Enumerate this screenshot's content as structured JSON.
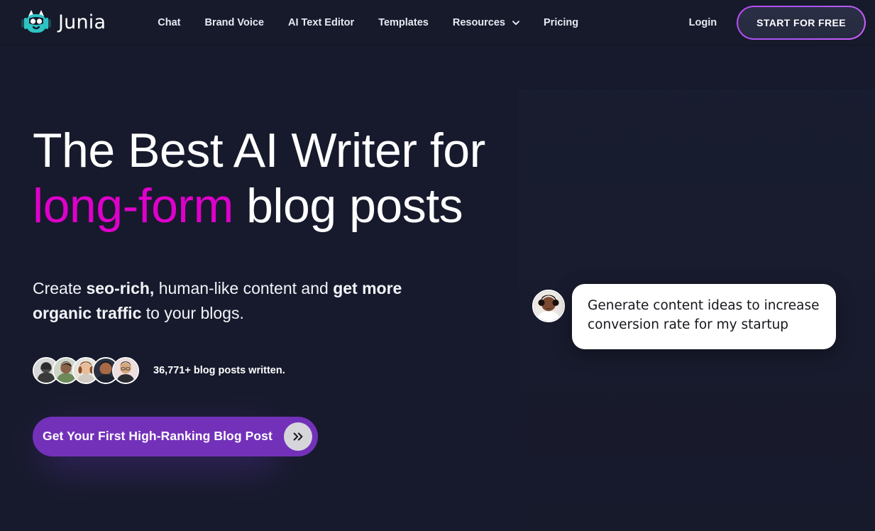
{
  "brand": {
    "name": "Junia",
    "logo_icon": "junia-robot-logo"
  },
  "nav": {
    "items": [
      {
        "label": "Chat",
        "has_dropdown": false
      },
      {
        "label": "Brand Voice",
        "has_dropdown": false
      },
      {
        "label": "AI Text Editor",
        "has_dropdown": false
      },
      {
        "label": "Templates",
        "has_dropdown": false
      },
      {
        "label": "Resources",
        "has_dropdown": true,
        "icon": "chevron-down-icon"
      },
      {
        "label": "Pricing",
        "has_dropdown": false
      }
    ],
    "login_label": "Login",
    "cta_label": "START FOR FREE"
  },
  "hero": {
    "headline_line1": "The Best AI Writer for",
    "headline_accent": "long-form",
    "headline_line2_rest": " blog posts",
    "sub_part1": "Create ",
    "sub_bold1": "seo-rich,",
    "sub_part2": " human-like content and ",
    "sub_bold2": "get more organic traffic",
    "sub_part3": " to your blogs.",
    "social_proof": "36,771+ blog posts written.",
    "cta_label": "Get Your First High-Ranking Blog Post",
    "cta_icon": "double-chevron-right-icon",
    "avatars": [
      {
        "name": "avatar-1",
        "alt": "user photo 1"
      },
      {
        "name": "avatar-2",
        "alt": "user photo 2"
      },
      {
        "name": "avatar-3",
        "alt": "user photo 3"
      },
      {
        "name": "avatar-4",
        "alt": "user photo 4"
      },
      {
        "name": "avatar-5",
        "alt": "user photo 5"
      }
    ]
  },
  "chat": {
    "avatar_name": "chat-user-avatar",
    "message": "Generate content ideas to increase conversion rate for my startup"
  },
  "colors": {
    "background": "#171a2c",
    "header_bg": "#161a2b",
    "accent_magenta": "#de00cb",
    "cta_purple": "#7331ba",
    "outline_purple": "#c04bf5",
    "logo_teal": "#2ec4c4",
    "bubble_bg": "#ffffff",
    "text_light": "#e7eaf2"
  }
}
